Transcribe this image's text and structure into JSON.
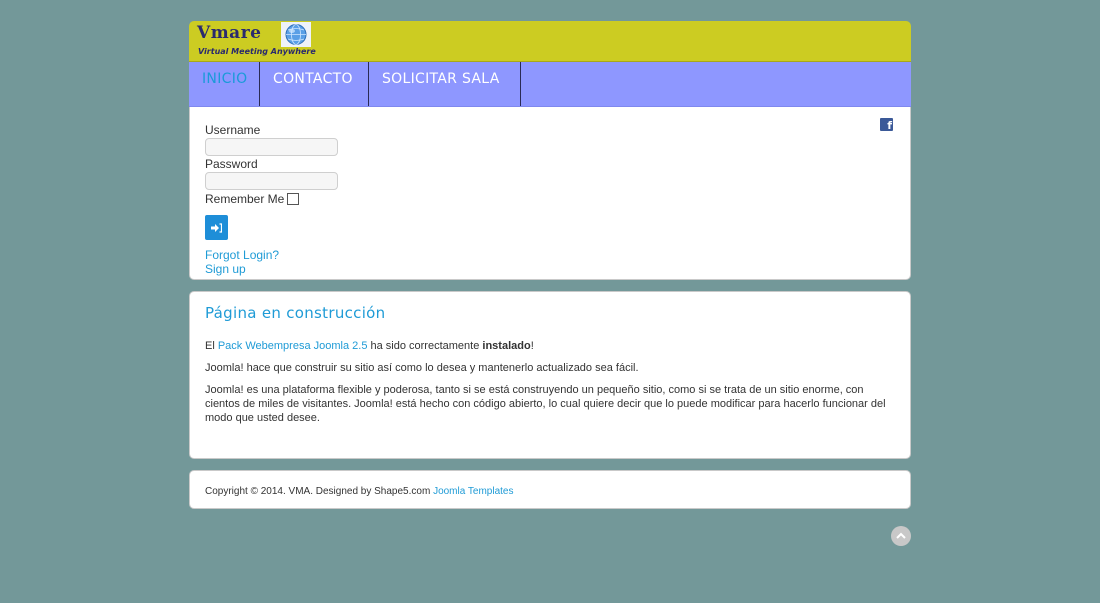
{
  "header": {
    "logo_text": "Vmare",
    "logo_tagline": "Virtual Meeting Anywhere"
  },
  "nav": {
    "items": [
      {
        "label": "INICIO",
        "active": true
      },
      {
        "label": "CONTACTO",
        "active": false
      },
      {
        "label": "SOLICITAR SALA",
        "active": false
      }
    ]
  },
  "login": {
    "username_label": "Username",
    "username_value": "",
    "password_label": "Password",
    "password_value": "",
    "remember_label": "Remember Me",
    "remember_checked": false,
    "submit_icon": "login-arrow-icon",
    "forgot_link": "Forgot Login?",
    "signup_link": "Sign up"
  },
  "social": {
    "icon": "facebook-icon",
    "glyph": "f"
  },
  "article": {
    "title": "Página en construcción",
    "p1_prefix": "El",
    "p1_link": "Pack Webempresa Joomla 2.5",
    "p1_middle": "ha sido correctamente",
    "p1_bold": "instalado",
    "p1_suffix": "!",
    "p2": "Joomla! hace que construir su sitio así como lo desea y mantenerlo actualizado sea fácil.",
    "p3": "Joomla! es una plataforma flexible y poderosa, tanto si se está construyendo un pequeño sitio, como si se trata de un sitio enorme, con cientos de miles de visitantes. Joomla! está hecho con código abierto, lo cual quiere decir que lo puede modificar para hacerlo funcionar del modo que usted desee."
  },
  "footer": {
    "text": "Copyright © 2014. VMA. Designed by Shape5.com",
    "link": "Joomla Templates"
  },
  "back_to_top": {
    "icon": "chevron-up-icon",
    "glyph": "^"
  },
  "colors": {
    "background": "#739899",
    "header": "#cccc22",
    "nav": "#8e97ff",
    "accent": "#1f9bd6"
  }
}
